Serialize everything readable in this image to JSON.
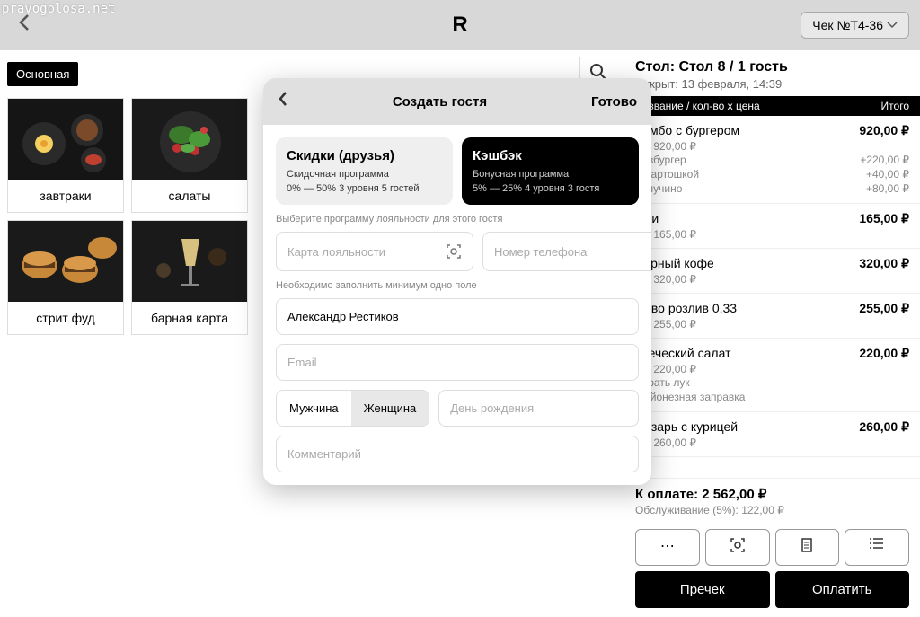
{
  "watermark": "pravogolosa.net",
  "logo": "R",
  "check_button": "Чек №Т4-36",
  "tab_main": "Основная",
  "categories": [
    {
      "label": "завтраки"
    },
    {
      "label": "салаты"
    },
    {
      "label": "",
      "hidden": true
    },
    {
      "label": "",
      "hidden": true
    },
    {
      "label": "стрит фуд"
    },
    {
      "label": "барная карта"
    }
  ],
  "order": {
    "title": "Стол: Стол 8 / 1 гость",
    "opened": "Открыт: 13 февраля, 14:39",
    "col_left": "Название / кол-во х цена",
    "col_right": "Итого",
    "items": [
      {
        "name": "Комбо с бургером",
        "qty": "1 × 920,00 ₽",
        "price": "920,00 ₽",
        "mods": [
          {
            "n": "Чизбургер",
            "p": "+220,00 ₽"
          },
          {
            "n": "С картошкой",
            "p": "+40,00 ₽"
          },
          {
            "n": "Капучино",
            "p": "+80,00 ₽"
          }
        ]
      },
      {
        "name": "Фри",
        "qty": "1 × 165,00 ₽",
        "price": "165,00 ₽"
      },
      {
        "name": "Чёрный кофе",
        "qty": "1 × 320,00 ₽",
        "price": "320,00 ₽"
      },
      {
        "name": "Пиво розлив 0.33",
        "qty": "1 × 255,00 ₽",
        "price": "255,00 ₽"
      },
      {
        "name": "Греческий салат",
        "qty": "1 × 220,00 ₽",
        "price": "220,00 ₽",
        "mods": [
          {
            "n": "Убрать лук",
            "p": ""
          },
          {
            "n": "Майонезная заправка",
            "p": ""
          }
        ]
      },
      {
        "name": "Цезарь с курицей",
        "qty": "1 × 260,00 ₽",
        "price": "260,00 ₽"
      }
    ],
    "total_label": "К оплате: 2 562,00 ₽",
    "service_label": "Обслуживание (5%): 122,00 ₽",
    "precheck": "Пречек",
    "pay": "Оплатить"
  },
  "modal": {
    "title": "Создать гостя",
    "done": "Готово",
    "programs": [
      {
        "title": "Скидки (друзья)",
        "sub": "Скидочная программа",
        "meta": "0% — 50%   3 уровня   5 гостей"
      },
      {
        "title": "Кэшбэк",
        "sub": "Бонусная программа",
        "meta": "5% — 25%   4 уровня   3 гостя"
      }
    ],
    "hint1": "Выберите программу лояльности для этого гостя",
    "card_ph": "Карта лояльности",
    "phone_ph": "Номер телефона",
    "hint2": "Необходимо заполнить минимум одно поле",
    "name_val": "Александр Рестиков",
    "email_ph": "Email",
    "gender_m": "Мужчина",
    "gender_f": "Женщина",
    "bday_ph": "День рождения",
    "comment_ph": "Комментарий"
  }
}
